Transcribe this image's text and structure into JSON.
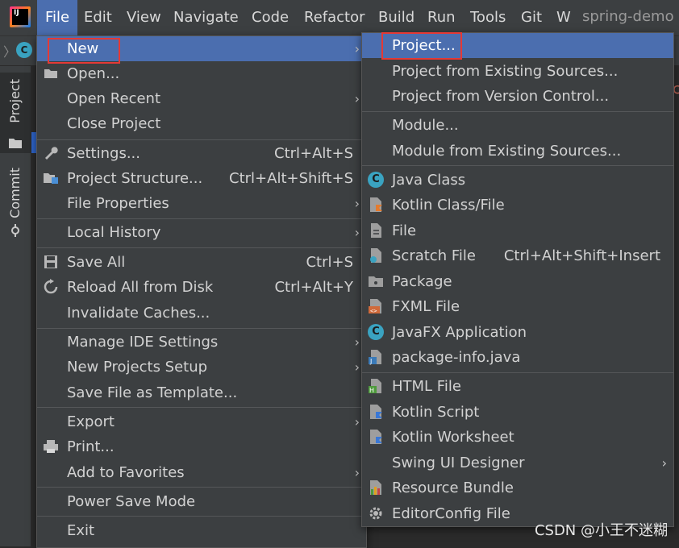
{
  "titlebar": {
    "logo_text": "IJ",
    "menus": [
      "File",
      "Edit",
      "View",
      "Navigate",
      "Code",
      "Refactor",
      "Build",
      "Run",
      "Tools",
      "Git",
      "W"
    ],
    "project_name": "spring-demo"
  },
  "toolbar": {
    "crumb_arrow": "〉",
    "crumb_icon": "C"
  },
  "sidebar": {
    "tabs": [
      "Project",
      "Commit"
    ]
  },
  "file_menu": {
    "items": [
      {
        "label": "New",
        "shortcut": "",
        "submenu": true,
        "icon": "none"
      },
      {
        "label": "Open...",
        "shortcut": "",
        "submenu": false,
        "icon": "folder-icon"
      },
      {
        "label": "Open Recent",
        "shortcut": "",
        "submenu": true,
        "icon": "none"
      },
      {
        "label": "Close Project",
        "shortcut": "",
        "submenu": false,
        "icon": "none"
      },
      {
        "label": "Settings...",
        "shortcut": "Ctrl+Alt+S",
        "submenu": false,
        "icon": "wrench-icon"
      },
      {
        "label": "Project Structure...",
        "shortcut": "Ctrl+Alt+Shift+S",
        "submenu": false,
        "icon": "project-structure-icon"
      },
      {
        "label": "File Properties",
        "shortcut": "",
        "submenu": true,
        "icon": "none"
      },
      {
        "label": "Local History",
        "shortcut": "",
        "submenu": true,
        "icon": "none"
      },
      {
        "label": "Save All",
        "shortcut": "Ctrl+S",
        "submenu": false,
        "icon": "save-icon"
      },
      {
        "label": "Reload All from Disk",
        "shortcut": "Ctrl+Alt+Y",
        "submenu": false,
        "icon": "reload-icon"
      },
      {
        "label": "Invalidate Caches...",
        "shortcut": "",
        "submenu": false,
        "icon": "none"
      },
      {
        "label": "Manage IDE Settings",
        "shortcut": "",
        "submenu": true,
        "icon": "none"
      },
      {
        "label": "New Projects Setup",
        "shortcut": "",
        "submenu": true,
        "icon": "none"
      },
      {
        "label": "Save File as Template...",
        "shortcut": "",
        "submenu": false,
        "icon": "none"
      },
      {
        "label": "Export",
        "shortcut": "",
        "submenu": true,
        "icon": "none"
      },
      {
        "label": "Print...",
        "shortcut": "",
        "submenu": false,
        "icon": "print-icon"
      },
      {
        "label": "Add to Favorites",
        "shortcut": "",
        "submenu": true,
        "icon": "none"
      },
      {
        "label": "Power Save Mode",
        "shortcut": "",
        "submenu": false,
        "icon": "none"
      },
      {
        "label": "Exit",
        "shortcut": "",
        "submenu": false,
        "icon": "none"
      }
    ]
  },
  "new_menu": {
    "items": [
      {
        "label": "Project...",
        "shortcut": "",
        "submenu": false,
        "icon": "none"
      },
      {
        "label": "Project from Existing Sources...",
        "shortcut": "",
        "submenu": false,
        "icon": "none"
      },
      {
        "label": "Project from Version Control...",
        "shortcut": "",
        "submenu": false,
        "icon": "none"
      },
      {
        "label": "Module...",
        "shortcut": "",
        "submenu": false,
        "icon": "none"
      },
      {
        "label": "Module from Existing Sources...",
        "shortcut": "",
        "submenu": false,
        "icon": "none"
      },
      {
        "label": "Java Class",
        "shortcut": "",
        "submenu": false,
        "icon": "java-class-icon"
      },
      {
        "label": "Kotlin Class/File",
        "shortcut": "",
        "submenu": false,
        "icon": "kotlin-file-icon"
      },
      {
        "label": "File",
        "shortcut": "",
        "submenu": false,
        "icon": "file-icon"
      },
      {
        "label": "Scratch File",
        "shortcut": "Ctrl+Alt+Shift+Insert",
        "submenu": false,
        "icon": "scratch-file-icon"
      },
      {
        "label": "Package",
        "shortcut": "",
        "submenu": false,
        "icon": "package-icon"
      },
      {
        "label": "FXML File",
        "shortcut": "",
        "submenu": false,
        "icon": "fxml-file-icon"
      },
      {
        "label": "JavaFX Application",
        "shortcut": "",
        "submenu": false,
        "icon": "javafx-app-icon"
      },
      {
        "label": "package-info.java",
        "shortcut": "",
        "submenu": false,
        "icon": "package-info-icon"
      },
      {
        "label": "HTML File",
        "shortcut": "",
        "submenu": false,
        "icon": "html-file-icon"
      },
      {
        "label": "Kotlin Script",
        "shortcut": "",
        "submenu": false,
        "icon": "kotlin-script-icon"
      },
      {
        "label": "Kotlin Worksheet",
        "shortcut": "",
        "submenu": false,
        "icon": "kotlin-worksheet-icon"
      },
      {
        "label": "Swing UI Designer",
        "shortcut": "",
        "submenu": true,
        "icon": "none"
      },
      {
        "label": "Resource Bundle",
        "shortcut": "",
        "submenu": false,
        "icon": "resource-bundle-icon"
      },
      {
        "label": "EditorConfig File",
        "shortcut": "",
        "submenu": false,
        "icon": "gear-icon"
      }
    ]
  },
  "watermark": "CSDN @小王不迷糊",
  "colors": {
    "highlight": "#4b6eaf",
    "menu_bg": "#3c3f41",
    "annotation": "#e53935"
  }
}
